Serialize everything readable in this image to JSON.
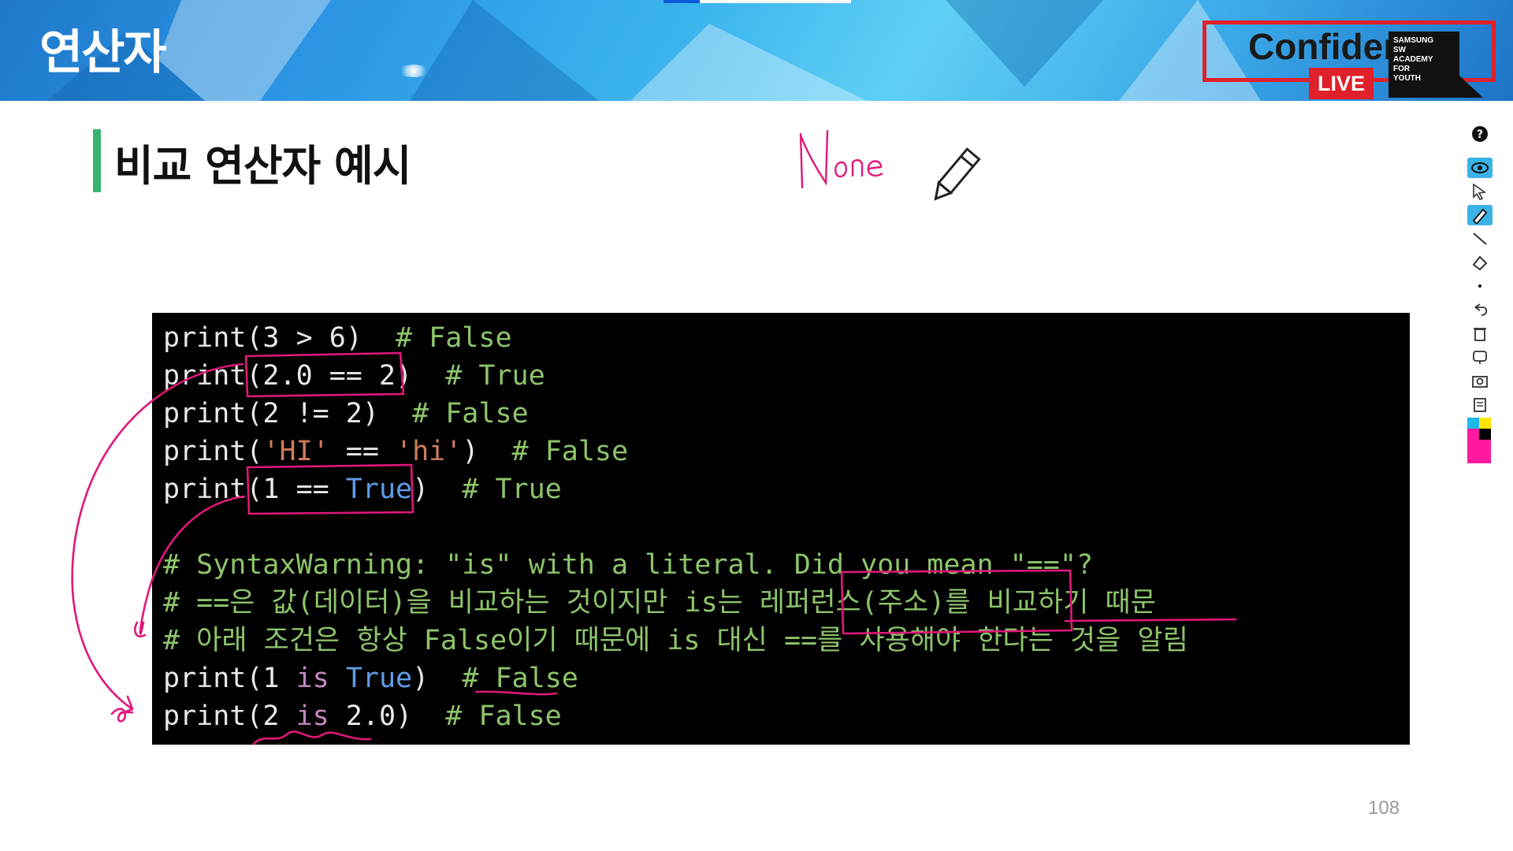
{
  "header": {
    "section_title": "연산자",
    "badge_text": "Confiden",
    "live_label": "LIVE",
    "academy_lines": [
      "SAMSUNG",
      "SW",
      "ACADEMY",
      "FOR",
      "YOUTH"
    ]
  },
  "slide": {
    "heading": "비교 연산자 예시",
    "handwritten_note": "None",
    "page_number": "108"
  },
  "code": {
    "lines": [
      {
        "code": "print(3 > 6)",
        "comment": "  # False"
      },
      {
        "code": "print(2.0 == 2)",
        "comment": "  # True"
      },
      {
        "code": "print(2 != 2)",
        "comment": "  # False"
      },
      {
        "pre": "print(",
        "str1": "'HI'",
        "mid": " == ",
        "str2": "'hi'",
        "post": ")",
        "comment": "  # False"
      },
      {
        "pre": "print(1 == ",
        "kw": "True",
        "post": ")",
        "comment": "  # True"
      },
      {
        "comment": "# SyntaxWarning: \"is\" with a literal. Did you mean \"==\"?"
      },
      {
        "comment": "# ==은 값(데이터)을 비교하는 것이지만 is는 레퍼런스(주소)를 비교하기 때문"
      },
      {
        "comment": "# 아래 조건은 항상 False이기 때문에 is 대신 ==를 사용해야 한다는 것을 알림"
      },
      {
        "pre": "print(1 ",
        "is": "is",
        "mid": " ",
        "kw": "True",
        "post": ")",
        "comment": "  # False"
      },
      {
        "pre": "print(2 ",
        "is": "is",
        "post": " 2.0)",
        "comment": "  # False"
      }
    ]
  },
  "toolbar": {
    "tools": [
      "help-icon",
      "eye-icon",
      "cursor-icon",
      "pen-icon",
      "line-icon",
      "eraser-icon",
      "dot-icon",
      "undo-icon",
      "trash-icon",
      "stamp-icon",
      "capture-icon",
      "clipboard-icon"
    ],
    "active_tools": [
      "eye-icon",
      "pen-icon"
    ],
    "palette_colors": [
      "#1fb8e8",
      "#ffe600",
      "#000000",
      "#ff1aa0"
    ]
  },
  "annotation_color": "#e0187a"
}
